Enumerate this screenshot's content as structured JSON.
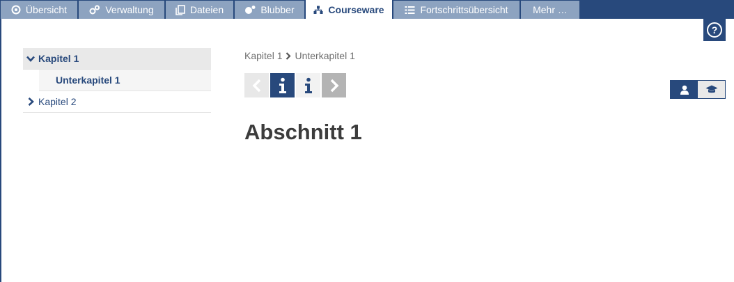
{
  "tabs": [
    {
      "label": "Übersicht",
      "icon": "seminar-icon"
    },
    {
      "label": "Verwaltung",
      "icon": "admin-gears-icon"
    },
    {
      "label": "Dateien",
      "icon": "files-icon"
    },
    {
      "label": "Blubber",
      "icon": "blubber-icon"
    },
    {
      "label": "Courseware",
      "icon": "courseware-icon",
      "active": true
    },
    {
      "label": "Fortschrittsübersicht",
      "icon": "progress-list-icon"
    },
    {
      "label": "Mehr …",
      "icon": ""
    }
  ],
  "help": {
    "icon": "help-icon"
  },
  "sidebar": {
    "items": [
      {
        "label": "Kapitel 1",
        "expanded": true,
        "active": true
      },
      {
        "label": "Unterkapitel 1",
        "sub": true,
        "active": true
      },
      {
        "label": "Kapitel 2",
        "expanded": false
      }
    ]
  },
  "breadcrumb": {
    "items": [
      "Kapitel 1",
      "Unterkapitel 1"
    ]
  },
  "navigation": {
    "buttons": [
      "prev-arrow-icon",
      "info-icon",
      "info-icon",
      "next-arrow-icon"
    ]
  },
  "view_toggle": {
    "options": [
      "student-view-icon",
      "teacher-view-icon"
    ],
    "selected": 0
  },
  "content": {
    "section_title": "Abschnitt 1"
  },
  "colors": {
    "accent": "#28497c",
    "tab_inactive": "#8da3c0",
    "text_grey": "#6e6e6e"
  }
}
